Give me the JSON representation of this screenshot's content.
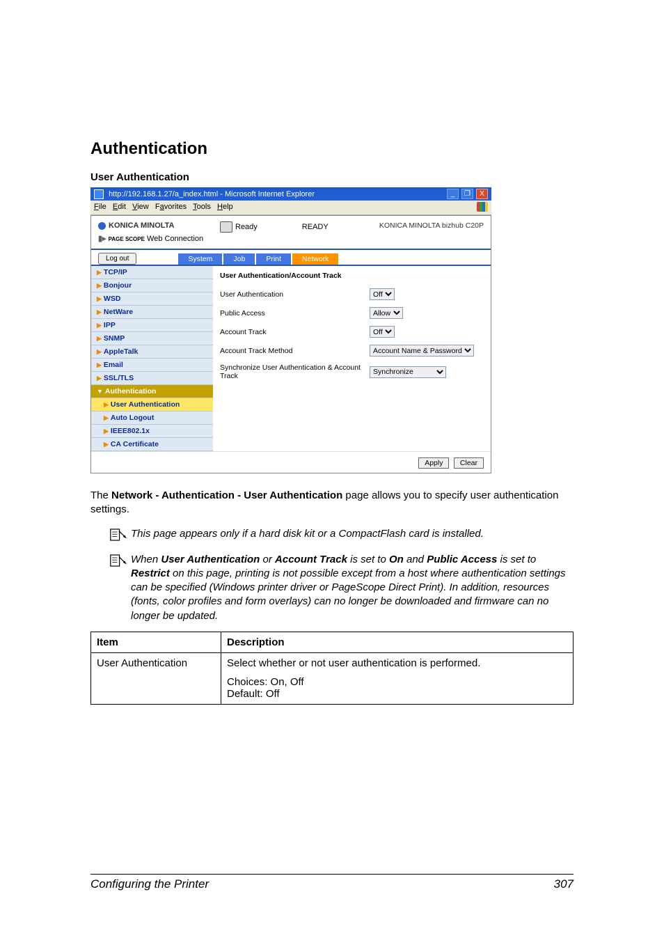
{
  "headings": {
    "section": "Authentication",
    "subsection": "User Authentication"
  },
  "browser": {
    "title": "http://192.168.1.27/a_index.html - Microsoft Internet Explorer",
    "menus": {
      "file": "File",
      "edit": "Edit",
      "view": "View",
      "favorites": "Favorites",
      "tools": "Tools",
      "help": "Help"
    }
  },
  "webconn": {
    "brand": "KONICA MINOLTA",
    "product": "Web Connection",
    "pagescope": "PAGE SCOPE",
    "statusLabel": "Ready",
    "statusWord": "READY",
    "model": "KONICA MINOLTA bizhub C20P",
    "logout": "Log out",
    "tabs": {
      "system": "System",
      "job": "Job",
      "print": "Print",
      "network": "Network"
    },
    "sidebar": {
      "tcpip": "TCP/IP",
      "bonjour": "Bonjour",
      "wsd": "WSD",
      "netware": "NetWare",
      "ipp": "IPP",
      "snmp": "SNMP",
      "appletalk": "AppleTalk",
      "email": "Email",
      "ssltls": "SSL/TLS",
      "auth": "Authentication",
      "userauth": "User Authentication",
      "autologout": "Auto Logout",
      "ieee": "IEEE802.1x",
      "cacert": "CA Certificate"
    },
    "main": {
      "title": "User Authentication/Account Track",
      "rows": {
        "r1": {
          "label": "User Authentication",
          "value": "Off"
        },
        "r2": {
          "label": "Public Access",
          "value": "Allow"
        },
        "r3": {
          "label": "Account Track",
          "value": "Off"
        },
        "r4": {
          "label": "Account Track Method",
          "value": "Account Name & Password"
        },
        "r5": {
          "label": "Synchronize User Authentication & Account Track",
          "value": "Synchronize"
        }
      },
      "buttons": {
        "apply": "Apply",
        "clear": "Clear"
      }
    }
  },
  "para": {
    "p1a": "The ",
    "p1b": "Network - Authentication - User Authentication",
    "p1c": " page allows you to specify user authentication settings."
  },
  "notes": {
    "n1": "This page appears only if a hard disk kit or a CompactFlash card is installed.",
    "n2": {
      "a": "When ",
      "b": "User Authentication",
      "c": " or ",
      "d": "Account Track",
      "e": " is set to ",
      "f": "On",
      "g": " and ",
      "h": "Public Access",
      "i": " is set to ",
      "j": "Restrict",
      "k": " on this page, printing is not possible except from a host where authentication settings can be specified (Windows printer driver or PageScope Direct Print). In addition, resources (fonts, color profiles and form overlays) can no longer be downloaded and firmware can no longer be updated."
    }
  },
  "table": {
    "head": {
      "col1": "Item",
      "col2": "Description"
    },
    "row1": {
      "item": "User Authentication",
      "desc1": "Select whether or not user authentication is performed.",
      "desc2a": "Choices: On, Off",
      "desc2b": "Default:  Off"
    }
  },
  "footer": {
    "left": "Configuring the Printer",
    "right": "307"
  }
}
